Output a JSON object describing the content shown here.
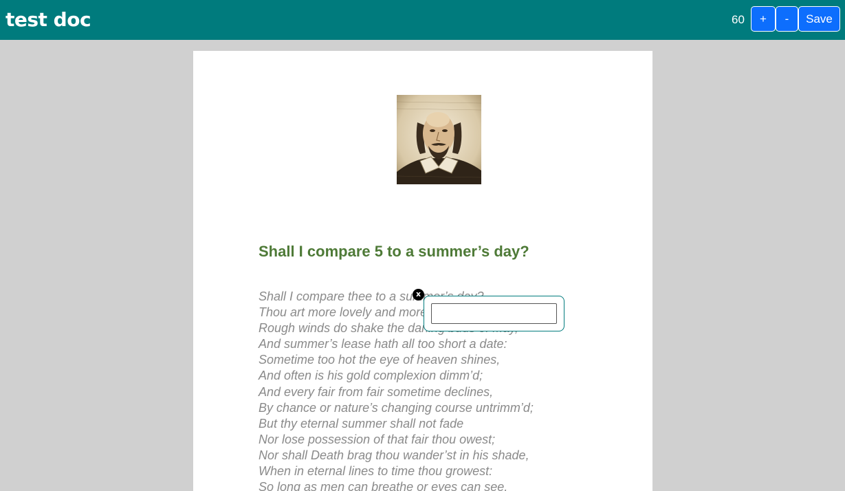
{
  "header": {
    "title": "test doc",
    "zoom": "60",
    "zoom_in_label": "+",
    "zoom_out_label": "-",
    "save_label": "Save",
    "background_color": "#007b7d",
    "button_color": "#0d6efd"
  },
  "document": {
    "image_icon": "portrait-image",
    "heading": "Shall I compare 5 to a summer’s day?",
    "heading_color": "#4e7a37",
    "lines": [
      "Shall I compare thee to a summer’s day?",
      "Thou art more lovely and more temperate:",
      "Rough winds do shake the darling buds of May,",
      "And summer’s lease hath all too short a date:",
      "Sometime too hot the eye of heaven shines,",
      "And often is his gold complexion dimm’d;",
      "And every fair from fair sometime declines,",
      "By chance or nature’s changing course untrimm’d;",
      "But thy eternal summer shall not fade",
      "Nor lose possession of that fair thou owest;",
      "Nor shall Death brag thou wander’st in his shade,",
      "When in eternal lines to time thou growest:",
      "So long as men can breathe or eyes can see,"
    ]
  },
  "annotation": {
    "close_label": "x",
    "input_value": "",
    "border_color": "#007b7d"
  }
}
